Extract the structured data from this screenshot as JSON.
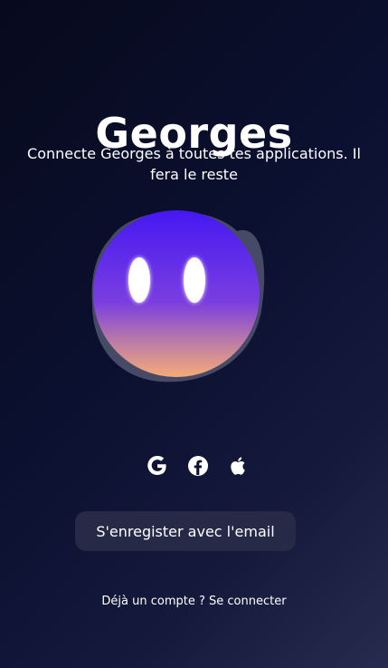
{
  "app": {
    "title": "Georges",
    "subtitle": "Connecte Georges à toutes tes applications. Il fera le reste"
  },
  "mascot": {
    "name": "mascot-blob",
    "colors": {
      "top": "#4b1cf0",
      "middle": "#7a3ee0",
      "bottom": "#f2a87a",
      "shadow": "#5a5d78",
      "eyes": "#ffffff"
    }
  },
  "social": {
    "items": [
      {
        "icon": "google-icon"
      },
      {
        "icon": "facebook-icon"
      },
      {
        "icon": "apple-icon"
      }
    ]
  },
  "actions": {
    "email_button_label": "S'enregister avec l'email",
    "login_prompt": "Déjà un compte ? Se connecter"
  },
  "theme": {
    "background_top": "#070a1c",
    "background_bottom": "#272b4f",
    "button_background": "#262a47",
    "text": "#ffffff"
  }
}
